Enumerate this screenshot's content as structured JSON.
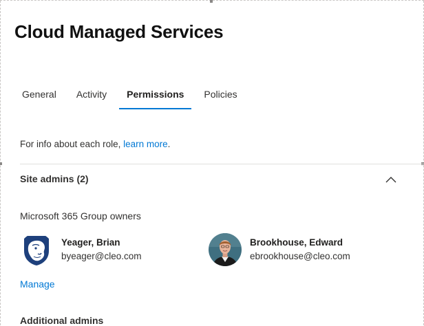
{
  "panel": {
    "title": "Cloud Managed Services"
  },
  "tabs": [
    {
      "label": "General",
      "active": false
    },
    {
      "label": "Activity",
      "active": false
    },
    {
      "label": "Permissions",
      "active": true
    },
    {
      "label": "Policies",
      "active": false
    }
  ],
  "info": {
    "text": "For info about each role, ",
    "link": "learn more",
    "suffix": "."
  },
  "site_admins": {
    "header": "Site admins (2)",
    "chevron_icon": "chevron-up-icon",
    "group_owners_label": "Microsoft 365 Group owners",
    "owners": [
      {
        "name": "Yeager, Brian",
        "email": "byeager@cleo.com",
        "avatar_icon": "nittany-lion-logo"
      },
      {
        "name": "Brookhouse, Edward",
        "email": "ebrookhouse@cleo.com",
        "avatar_icon": "person-photo"
      }
    ],
    "manage_label": "Manage"
  },
  "additional_admins": {
    "header": "Additional admins"
  },
  "colors": {
    "accent": "#0078d4",
    "text": "#323130",
    "divider": "#e1dfdd",
    "lion_blue": "#1e407c"
  }
}
